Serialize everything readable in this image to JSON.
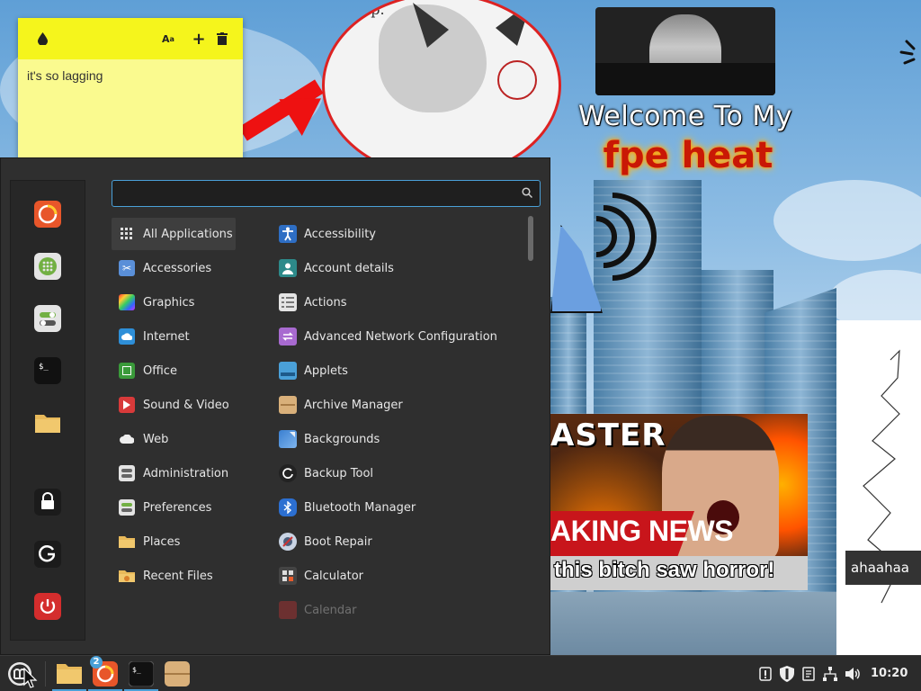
{
  "sticky_note": {
    "text": "it's so lagging",
    "icons": [
      "drop-icon",
      "font-size-icon",
      "add-icon",
      "trash-icon"
    ],
    "header_color": "#f5f51c",
    "body_color": "#fafa8f"
  },
  "wallpaper": {
    "circle_text": "Sup.",
    "welcome_text": "Welcome To My",
    "fire_text": "fpe heat",
    "thumb_top": "ASTER",
    "thumb_news": "AKING NEWS",
    "thumb_caption": "this bitch saw horror!",
    "side_caption": "ahaahaa"
  },
  "menu": {
    "search": {
      "value": "",
      "placeholder": ""
    },
    "favorites": [
      {
        "name": "firefox",
        "icon": "firefox-icon"
      },
      {
        "name": "software-manager",
        "icon": "software-manager-icon"
      },
      {
        "name": "system-settings",
        "icon": "toggles-icon"
      },
      {
        "name": "terminal",
        "icon": "terminal-icon"
      },
      {
        "name": "files",
        "icon": "folder-icon"
      },
      {
        "name": "lock-screen",
        "icon": "lock-icon"
      },
      {
        "name": "logout",
        "icon": "logout-icon"
      },
      {
        "name": "shutdown",
        "icon": "power-icon"
      }
    ],
    "categories": [
      {
        "label": "All Applications",
        "icon": "grid-icon",
        "active": true
      },
      {
        "label": "Accessories",
        "icon": "scissors-icon"
      },
      {
        "label": "Graphics",
        "icon": "graphics-icon"
      },
      {
        "label": "Internet",
        "icon": "cloud-icon"
      },
      {
        "label": "Office",
        "icon": "office-icon"
      },
      {
        "label": "Sound & Video",
        "icon": "play-icon"
      },
      {
        "label": "Web",
        "icon": "web-cloud-icon"
      },
      {
        "label": "Administration",
        "icon": "admin-icon"
      },
      {
        "label": "Preferences",
        "icon": "preferences-icon"
      },
      {
        "label": "Places",
        "icon": "folder-icon"
      },
      {
        "label": "Recent Files",
        "icon": "recent-folder-icon"
      }
    ],
    "apps": [
      {
        "label": "Accessibility",
        "icon": "accessibility-icon"
      },
      {
        "label": "Account details",
        "icon": "account-icon"
      },
      {
        "label": "Actions",
        "icon": "actions-icon"
      },
      {
        "label": "Advanced Network Configuration",
        "icon": "network-config-icon"
      },
      {
        "label": "Applets",
        "icon": "applets-icon"
      },
      {
        "label": "Archive Manager",
        "icon": "archive-icon"
      },
      {
        "label": "Backgrounds",
        "icon": "backgrounds-icon"
      },
      {
        "label": "Backup Tool",
        "icon": "backup-icon"
      },
      {
        "label": "Bluetooth Manager",
        "icon": "bluetooth-icon"
      },
      {
        "label": "Boot Repair",
        "icon": "boot-repair-icon"
      },
      {
        "label": "Calculator",
        "icon": "calculator-icon"
      },
      {
        "label": "Calendar",
        "icon": "calendar-icon"
      }
    ]
  },
  "taskbar": {
    "firefox_badge": "2",
    "clock": "10:20",
    "tray_icons": [
      "notification-icon",
      "update-shield-icon",
      "clipboard-icon",
      "network-icon",
      "volume-icon"
    ],
    "accent_color": "#4aa0d8"
  }
}
